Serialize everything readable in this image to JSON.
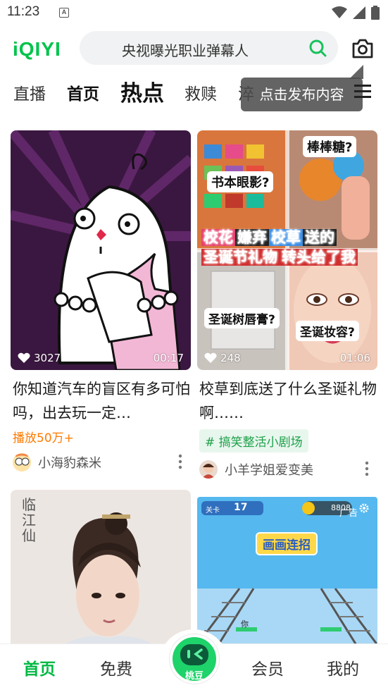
{
  "status": {
    "time": "11:23",
    "notif_letter": "A"
  },
  "header": {
    "logo": "iQIYI",
    "search_text": "央视曝光职业弹幕人"
  },
  "tabs": [
    "直播",
    "首页",
    "热点",
    "救赎",
    "淬",
    "",
    "",
    ""
  ],
  "tab_items": [
    {
      "label": "直播"
    },
    {
      "label": "首页"
    },
    {
      "label": "热点",
      "active": true
    },
    {
      "label": "救赎"
    },
    {
      "label": "淬"
    }
  ],
  "tooltip": "点击发布内容",
  "cards": [
    {
      "likes": "3027",
      "duration": "00:17",
      "title": "你知道汽车的盲区有多可怕吗，出去玩一定…",
      "plays": "播放50万+",
      "author": "小海豹森米"
    },
    {
      "likes": "248",
      "duration": "01:06",
      "title": "校草到底送了什么圣诞礼物啊……",
      "topic": "# 搞笑整活小剧场",
      "author": "小羊学姐爱变美",
      "thumb_texts": [
        "棒棒糖?",
        "书本眼影?",
        "校花",
        "嫌弃",
        "校草",
        "送的",
        "圣诞节礼物",
        "转头给了我",
        "圣诞树唇膏?",
        "圣诞妆容?"
      ]
    },
    {
      "thumb_text": "临江仙"
    },
    {
      "level_label": "关卡",
      "level": "17",
      "coins": "8808",
      "ad_label": "广告",
      "game_title": "画画连招",
      "player_label": "你"
    }
  ],
  "bottom_nav": {
    "home": "首页",
    "free": "免费",
    "center": "桃豆",
    "vip": "会员",
    "mine": "我的"
  },
  "colors": {
    "brand_green": "#00c34a",
    "plays_orange": "#ff7a00",
    "topic_green": "#1fa04a"
  }
}
